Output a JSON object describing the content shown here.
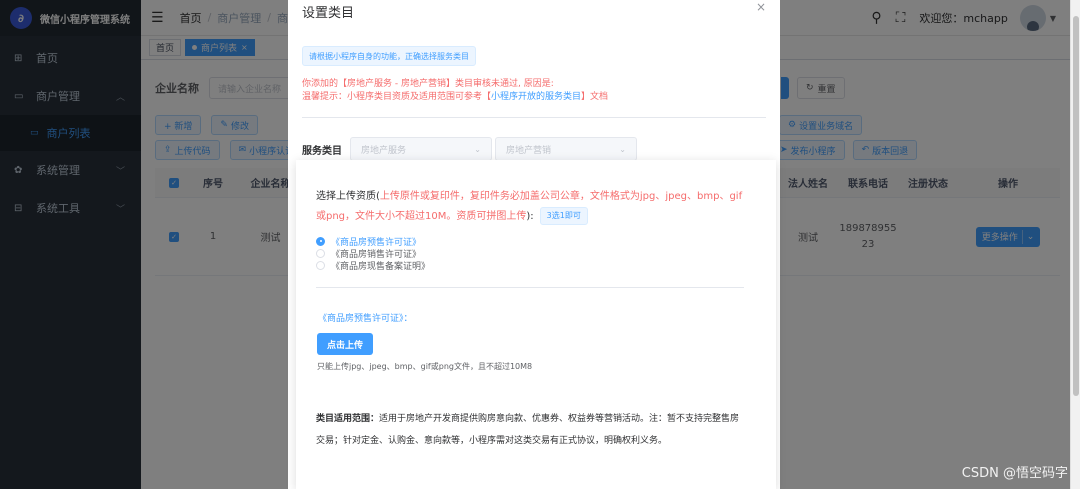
{
  "sidebar": {
    "brand_title": "微信小程序管理系统",
    "logo_glyph": "∂",
    "items": [
      {
        "label": "首页",
        "icon": "dashboard-icon"
      },
      {
        "label": "商户管理",
        "icon": "shop-icon"
      },
      {
        "label": "系统管理",
        "icon": "gear-icon"
      },
      {
        "label": "系统工具",
        "icon": "toolbox-icon"
      }
    ],
    "sub_active": "商户列表"
  },
  "header": {
    "breadcrumb": [
      "首页",
      "商户管理",
      "商户列表"
    ],
    "welcome": "欢迎您：mchapp"
  },
  "tags": [
    {
      "label": "首页",
      "active": false
    },
    {
      "label": "商户列表",
      "active": true
    }
  ],
  "search": {
    "label": "企业名称",
    "placeholder": "请输入企业名称",
    "reset_label": "重置"
  },
  "toolbar": {
    "row1": [
      "+ 新增",
      "修改"
    ],
    "row2": [
      "上传代码",
      "小程序认证"
    ],
    "right1": "设置业务域名",
    "right2": [
      "发布小程序",
      "版本回退"
    ]
  },
  "table": {
    "headers": [
      "序号",
      "企业名称",
      "法人姓名",
      "联系电话",
      "注册状态",
      "操作"
    ],
    "row": {
      "index": "1",
      "company": "测试",
      "legal_person": "测试",
      "phone_line1": "189878955",
      "phone_line2": "23",
      "action": "更多操作"
    }
  },
  "modal": {
    "title": "设置类目",
    "info": "请根据小程序自身的功能，正确选择服务类目",
    "warn_line1": "你添加的【房地产服务 - 房地产营销】类目审核未通过, 原因是:",
    "warn_line2_prefix": "温馨提示：小程序类目资质及适用范围可参考【",
    "warn_link": "小程序开放的服务类目",
    "warn_line2_suffix": "】文档",
    "category_label": "服务类目",
    "select1": "房地产服务",
    "select2": "房地产营销",
    "upload_intro_prefix": "选择上传资质(",
    "upload_intro_red": "上传原件或复印件，复印件务必加盖公司公章，文件格式为jpg、jpeg、bmp、gif或png，文件大小不超过10M。资质可拼图上传",
    "upload_intro_suffix": "):",
    "choice_tag": "3选1即可",
    "options": [
      "《商品房预售许可证》",
      "《商品房销售许可证》",
      "《商品房现售备案证明》"
    ],
    "selected_doc": "《商品房预售许可证》：",
    "upload_button": "点击上传",
    "upload_tip": "只能上传jpg、jpeg、bmp、gif或png文件，且不超过10M8",
    "scope_label": "类目适用范围：",
    "scope_text": "适用于房地产开发商提供购房意向款、优惠券、权益券等营销活动。注：暂不支持完整售房交易；针对定金、认购金、意向款等，小程序需对这类交易有正式协议，明确权利义务。"
  },
  "watermark": "CSDN @悟空码字",
  "colors": {
    "primary": "#409eff",
    "danger": "#f56c6c",
    "sidebar_bg": "#28313b"
  }
}
